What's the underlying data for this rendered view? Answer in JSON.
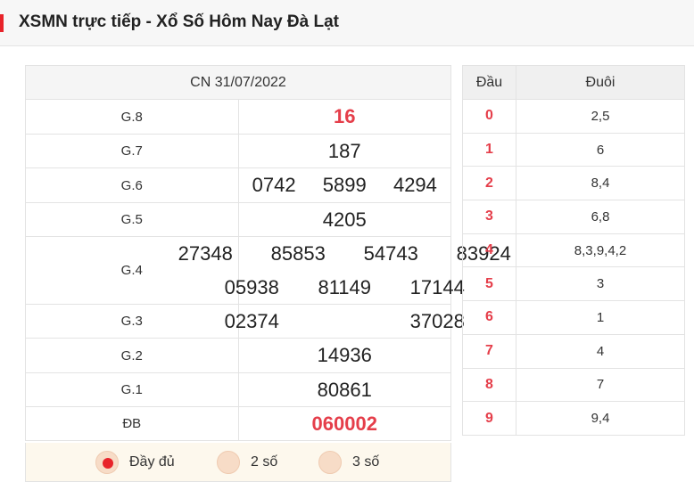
{
  "header": {
    "title": "XSMN trực tiếp - Xổ Số Hôm Nay Đà Lạt"
  },
  "results": {
    "date": "CN 31/07/2022",
    "prizes": [
      {
        "label": "G.8",
        "numbers": [
          "16"
        ]
      },
      {
        "label": "G.7",
        "numbers": [
          "187"
        ]
      },
      {
        "label": "G.6",
        "numbers": [
          "0742",
          "5899",
          "4294"
        ]
      },
      {
        "label": "G.5",
        "numbers": [
          "4205"
        ]
      },
      {
        "label": "G.4",
        "numbers": [
          "27348",
          "85853",
          "54743",
          "83924",
          "05938",
          "81149",
          "17144"
        ]
      },
      {
        "label": "G.3",
        "numbers": [
          "02374",
          "37028"
        ]
      },
      {
        "label": "G.2",
        "numbers": [
          "14936"
        ]
      },
      {
        "label": "G.1",
        "numbers": [
          "80861"
        ]
      },
      {
        "label": "ĐB",
        "numbers": [
          "060002"
        ]
      }
    ]
  },
  "options": {
    "selected": "full",
    "full_label": "Đầy đủ",
    "two_label": "2 số",
    "three_label": "3 số"
  },
  "dau_duoi": {
    "head_label": "Đầu",
    "tail_label": "Đuôi",
    "rows": [
      {
        "dau": "0",
        "duoi": "2,5"
      },
      {
        "dau": "1",
        "duoi": "6"
      },
      {
        "dau": "2",
        "duoi": "8,4"
      },
      {
        "dau": "3",
        "duoi": "6,8"
      },
      {
        "dau": "4",
        "duoi": "8,3,9,4,2"
      },
      {
        "dau": "5",
        "duoi": "3"
      },
      {
        "dau": "6",
        "duoi": "1"
      },
      {
        "dau": "7",
        "duoi": "4"
      },
      {
        "dau": "8",
        "duoi": "7"
      },
      {
        "dau": "9",
        "duoi": "9,4"
      }
    ]
  },
  "colors": {
    "accent": "#e8232a",
    "highlight": "#e53e4a"
  }
}
